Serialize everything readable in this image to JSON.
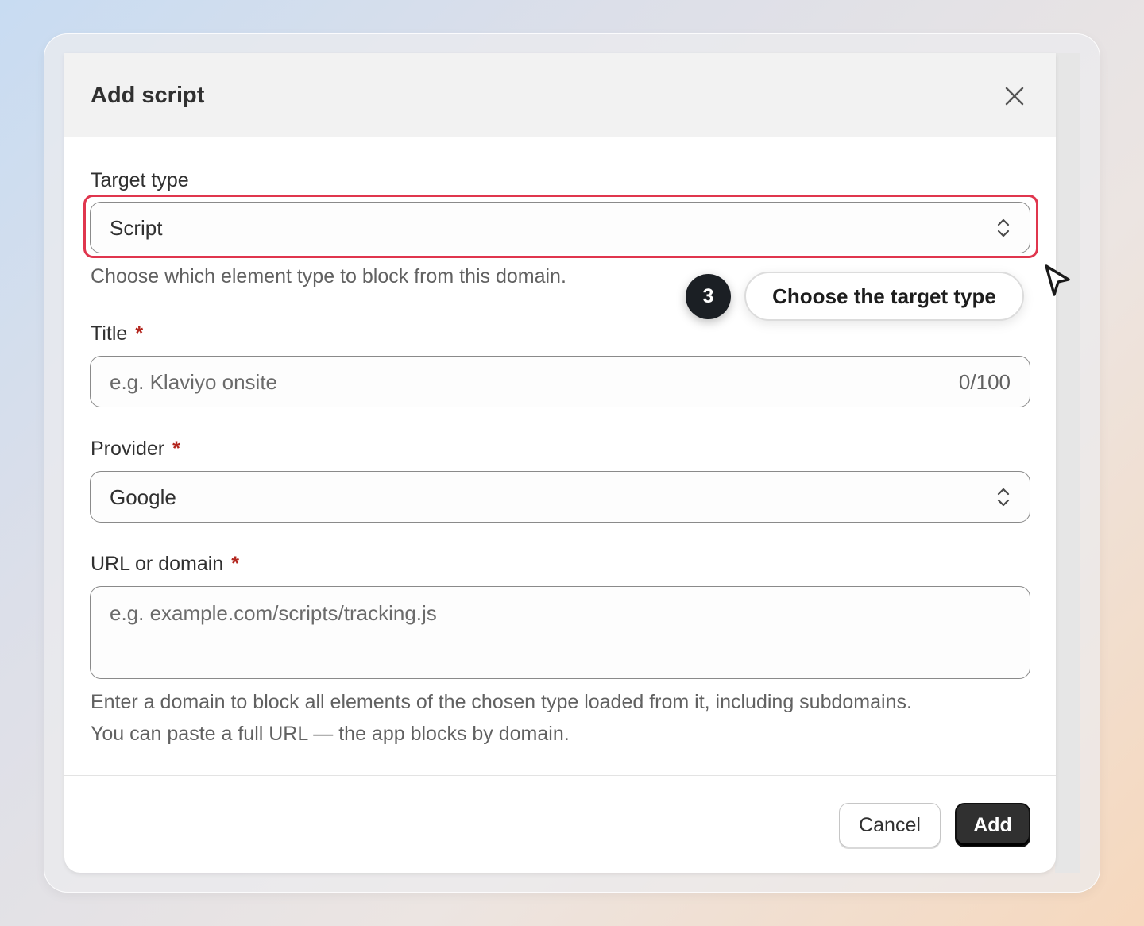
{
  "modal": {
    "title": "Add script",
    "close_icon": "close-icon"
  },
  "target_type": {
    "label": "Target type",
    "value": "Script",
    "help": "Choose which element type to block from this domain.",
    "icon": "chevron-up-down-icon"
  },
  "title_field": {
    "label": "Title",
    "required_mark": "*",
    "placeholder": "e.g. Klaviyo onsite",
    "counter": "0/100"
  },
  "provider": {
    "label": "Provider",
    "required_mark": "*",
    "value": "Google",
    "icon": "chevron-up-down-icon"
  },
  "url_field": {
    "label": "URL or domain",
    "required_mark": "*",
    "placeholder": "e.g. example.com/scripts/tracking.js",
    "help_line1": "Enter a domain to block all elements of the chosen type loaded from it, including subdomains.",
    "help_line2": "You can paste a full URL — the app blocks by domain."
  },
  "footer": {
    "cancel_label": "Cancel",
    "add_label": "Add"
  },
  "tutorial": {
    "step_number": "3",
    "tooltip": "Choose the target type",
    "highlight_color": "#e0364e",
    "cursor_icon": "pointer-cursor-icon"
  },
  "colors": {
    "primary_button": "#303030",
    "required": "#b3261e"
  }
}
